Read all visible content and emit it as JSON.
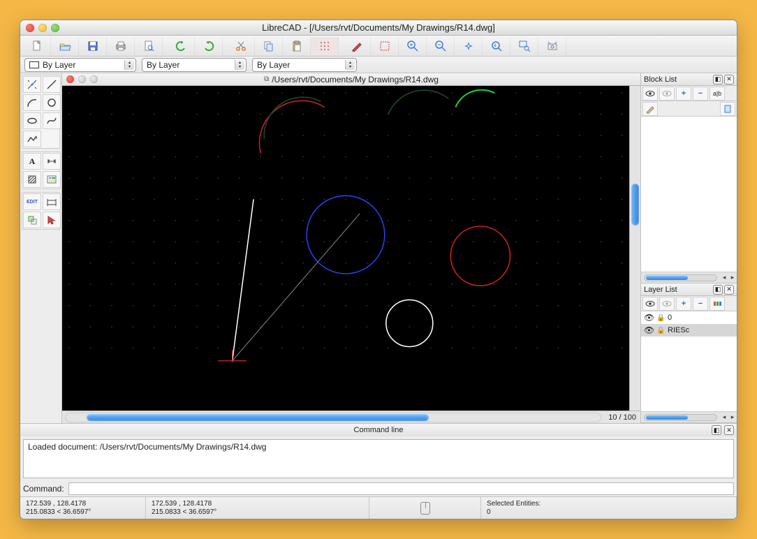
{
  "window": {
    "title": "LibreCAD - [/Users/rvt/Documents/My Drawings/R14.dwg]"
  },
  "dropdowns": {
    "layer_color": "By Layer",
    "line_type": "By Layer",
    "line_width": "By Layer"
  },
  "document": {
    "title": "/Users/rvt/Documents/My Drawings/R14.dwg"
  },
  "zoom": "10 / 100",
  "block_list": {
    "title": "Block List"
  },
  "layer_list": {
    "title": "Layer List",
    "layers": [
      {
        "name": "0",
        "visible": true,
        "locked": true
      },
      {
        "name": "RIESc",
        "visible": true,
        "locked": true,
        "selected": true
      }
    ]
  },
  "command_line": {
    "title": "Command line",
    "history": "Loaded document: /Users/rvt/Documents/My Drawings/R14.dwg",
    "prompt": "Command:",
    "value": ""
  },
  "status": {
    "abs1": "172.539 , 128.4178",
    "rel1": "215.0833 < 36.6597°",
    "abs2": "172.539 , 128.4178",
    "rel2": "215.0833 < 36.6597°",
    "sel_label": "Selected Entities:",
    "sel_count": "0"
  },
  "icons": {
    "plus": "+",
    "minus": "−",
    "text_tool": "A",
    "edit": "EDIT",
    "arrow_left": "◂",
    "arrow_right": "▸"
  }
}
